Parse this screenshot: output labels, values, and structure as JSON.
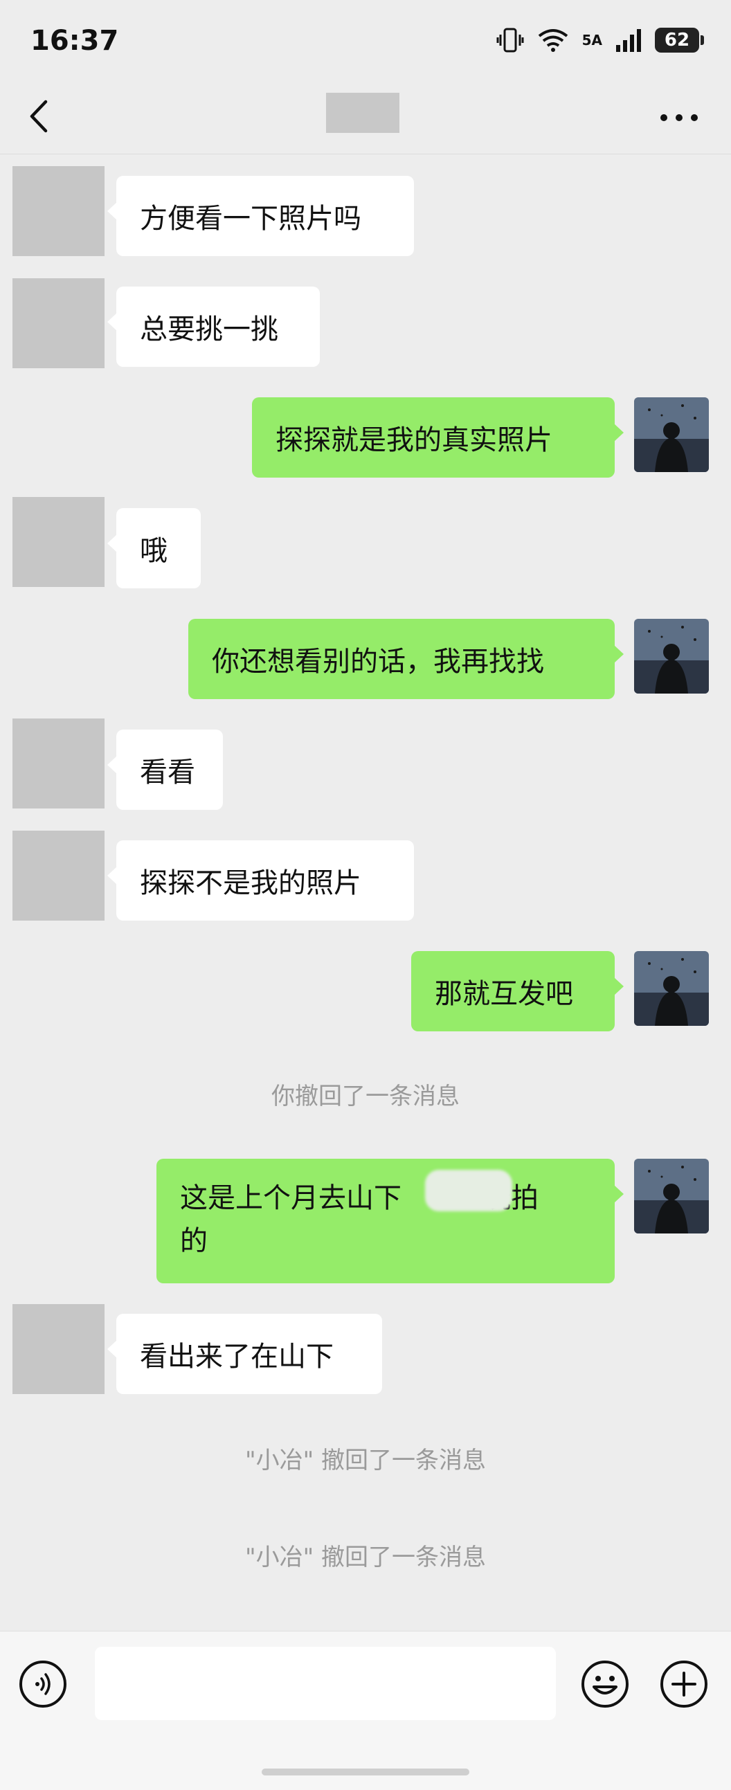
{
  "status_bar": {
    "time": "16:37",
    "network": "5A",
    "battery": "62"
  },
  "header": {
    "contact_name": ""
  },
  "messages": [
    {
      "side": "left",
      "text": "方便看一下照片吗"
    },
    {
      "side": "left",
      "text": "总要挑一挑"
    },
    {
      "side": "right",
      "text": "探探就是我的真实照片"
    },
    {
      "side": "left",
      "text": "哦"
    },
    {
      "side": "right",
      "text": "你还想看别的话，我再找找"
    },
    {
      "side": "left",
      "text": "看看"
    },
    {
      "side": "left",
      "text": "探探不是我的照片"
    },
    {
      "side": "right",
      "text": "那就互发吧"
    },
    {
      "side": "system",
      "text": "你撤回了一条消息"
    },
    {
      "side": "right",
      "line1": "这是上个月去山下",
      "line1_tail": "玩拍",
      "line2": "的"
    },
    {
      "side": "left",
      "text": "看出来了在山下"
    },
    {
      "side": "system",
      "text": "\"小冶\" 撤回了一条消息"
    },
    {
      "side": "system",
      "text": "\"小冶\" 撤回了一条消息"
    }
  ],
  "input": {
    "value": "",
    "voice_icon": "voice-icon",
    "emoji_icon": "emoji-icon",
    "plus_icon": "plus-icon"
  },
  "colors": {
    "background": "#ededed",
    "outgoing_bubble": "#95ec69",
    "incoming_bubble": "#ffffff"
  }
}
